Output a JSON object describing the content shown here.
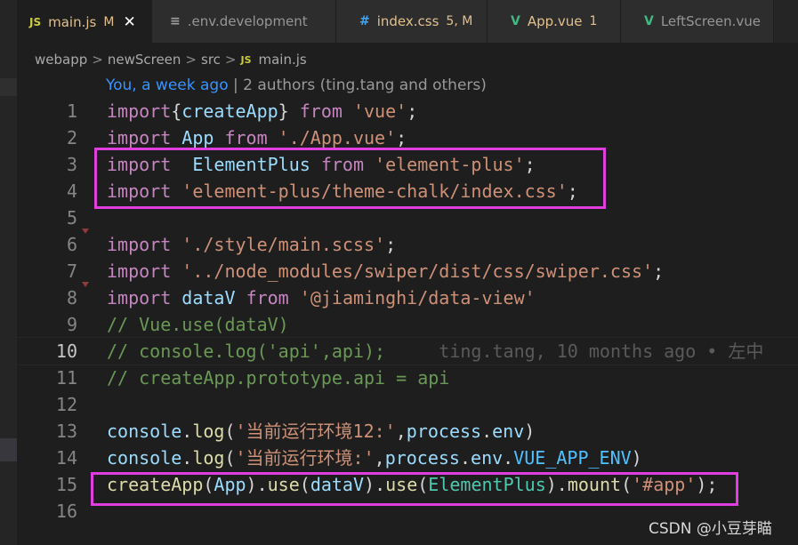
{
  "tabs": [
    {
      "icon": "JS",
      "label": "main.js",
      "status": "M",
      "active": true,
      "close": "✕"
    },
    {
      "icon": "≡",
      "label": ".env.development",
      "status": "",
      "active": false
    },
    {
      "icon": "#",
      "label": "index.css",
      "status": "5, M",
      "active": false
    },
    {
      "icon": "V",
      "label": "App.vue",
      "status": "1",
      "active": false
    },
    {
      "icon": "V",
      "label": "LeftScreen.vue",
      "status": "",
      "active": false
    }
  ],
  "breadcrumb": {
    "parts": [
      "webapp",
      "newScreen",
      "src"
    ],
    "separator": ">",
    "file_icon": "JS",
    "file": "main.js"
  },
  "codelens": {
    "author": "You, a week ago",
    "divider": " | ",
    "rest": "2 authors (ting.tang and others)"
  },
  "lines": [
    {
      "n": "1",
      "t": [
        [
          "kw",
          "import"
        ],
        [
          "",
          "{"
        ],
        [
          "var",
          "createApp"
        ],
        [
          "",
          "} "
        ],
        [
          "kw",
          "from"
        ],
        [
          "",
          ""
        ],
        [
          "str",
          " 'vue'"
        ],
        [
          "",
          ";"
        ]
      ]
    },
    {
      "n": "2",
      "t": [
        [
          "kw",
          "import"
        ],
        [
          "",
          " "
        ],
        [
          "var",
          "App"
        ],
        [
          "",
          " "
        ],
        [
          "kw",
          "from"
        ],
        [
          "str",
          " './App.vue'"
        ],
        [
          "",
          ";"
        ]
      ]
    },
    {
      "n": "3",
      "t": [
        [
          "kw",
          "import"
        ],
        [
          "",
          "  "
        ],
        [
          "var",
          "ElementPlus"
        ],
        [
          "",
          " "
        ],
        [
          "kw",
          "from"
        ],
        [
          "str",
          " 'element-plus'"
        ],
        [
          "",
          ";"
        ]
      ]
    },
    {
      "n": "4",
      "t": [
        [
          "kw",
          "import"
        ],
        [
          "str",
          " 'element-plus/theme-chalk/index.css'"
        ],
        [
          "",
          ";"
        ]
      ]
    },
    {
      "n": "5",
      "t": []
    },
    {
      "n": "6",
      "t": [
        [
          "kw",
          "import"
        ],
        [
          "str",
          " './style/main.scss'"
        ],
        [
          "",
          ";"
        ]
      ]
    },
    {
      "n": "7",
      "t": [
        [
          "kw",
          "import"
        ],
        [
          "str",
          " '../node_modules/swiper/dist/css/swiper.css'"
        ],
        [
          "",
          ";"
        ]
      ]
    },
    {
      "n": "8",
      "t": [
        [
          "kw",
          "import"
        ],
        [
          "",
          " "
        ],
        [
          "var",
          "dataV"
        ],
        [
          "",
          " "
        ],
        [
          "kw",
          "from"
        ],
        [
          "str",
          " '@jiaminghi/data-view'"
        ]
      ]
    },
    {
      "n": "9",
      "t": [
        [
          "cm",
          "// Vue.use(dataV)"
        ]
      ]
    },
    {
      "n": "10",
      "t": [
        [
          "cm",
          "// console.log('api',api);"
        ],
        [
          "blame",
          "     ting.tang, 10 months ago • 左中"
        ]
      ],
      "current": true
    },
    {
      "n": "11",
      "t": [
        [
          "cm",
          "// createApp.prototype.api = api"
        ]
      ]
    },
    {
      "n": "12",
      "t": []
    },
    {
      "n": "13",
      "t": [
        [
          "var",
          "console"
        ],
        [
          "",
          "."
        ],
        [
          "fn",
          "log"
        ],
        [
          "",
          "("
        ],
        [
          "str",
          "'当前运行环境12:'"
        ],
        [
          "",
          ","
        ],
        [
          "var",
          "process"
        ],
        [
          "",
          "."
        ],
        [
          "var",
          "env"
        ],
        [
          "",
          ")"
        ]
      ]
    },
    {
      "n": "14",
      "t": [
        [
          "var",
          "console"
        ],
        [
          "",
          "."
        ],
        [
          "fn",
          "log"
        ],
        [
          "",
          "("
        ],
        [
          "str",
          "'当前运行环境:'"
        ],
        [
          "",
          ","
        ],
        [
          "var",
          "process"
        ],
        [
          "",
          "."
        ],
        [
          "var",
          "env"
        ],
        [
          "",
          "."
        ],
        [
          "env",
          "VUE_APP_ENV"
        ],
        [
          "",
          ")"
        ]
      ]
    },
    {
      "n": "15",
      "t": [
        [
          "fn",
          "createApp"
        ],
        [
          "",
          "("
        ],
        [
          "var",
          "App"
        ],
        [
          "",
          ")."
        ],
        [
          "fn",
          "use"
        ],
        [
          "",
          "("
        ],
        [
          "var",
          "dataV"
        ],
        [
          "",
          ")."
        ],
        [
          "fn",
          "use"
        ],
        [
          "",
          "("
        ],
        [
          "cls",
          "ElementPlus"
        ],
        [
          "",
          ")."
        ],
        [
          "fn",
          "mount"
        ],
        [
          "",
          "("
        ],
        [
          "str",
          "'#app'"
        ],
        [
          "",
          ");"
        ]
      ]
    },
    {
      "n": "16",
      "t": []
    }
  ],
  "watermark": "CSDN @小豆芽瞄",
  "colors": {
    "background": "#1e1e1e",
    "keyword": "#c586c0",
    "string": "#ce9178",
    "variable": "#9cdcfe",
    "function": "#dcdcaa",
    "comment": "#6a9955",
    "highlight_box": "#e13ee0"
  }
}
